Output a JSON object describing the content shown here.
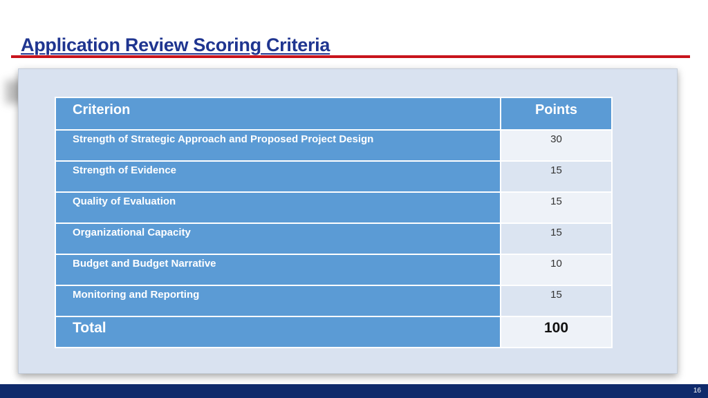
{
  "slide": {
    "title": "Application Review Scoring Criteria",
    "page_number": "16"
  },
  "table": {
    "headers": {
      "criterion": "Criterion",
      "points": "Points"
    },
    "rows": [
      {
        "criterion": "Strength of Strategic Approach and Proposed Project Design",
        "points": "30"
      },
      {
        "criterion": "Strength of Evidence",
        "points": "15"
      },
      {
        "criterion": "Quality of Evaluation",
        "points": "15"
      },
      {
        "criterion": "Organizational Capacity",
        "points": "15"
      },
      {
        "criterion": "Budget and Budget Narrative",
        "points": "10"
      },
      {
        "criterion": "Monitoring and Reporting",
        "points": "15"
      }
    ],
    "total": {
      "label": "Total",
      "points": "100"
    }
  },
  "colors": {
    "title": "#1f3590",
    "rule": "#c8141c",
    "header_fill": "#5b9bd5",
    "panel": "#d9e2f0",
    "footer": "#0f2a6b"
  }
}
